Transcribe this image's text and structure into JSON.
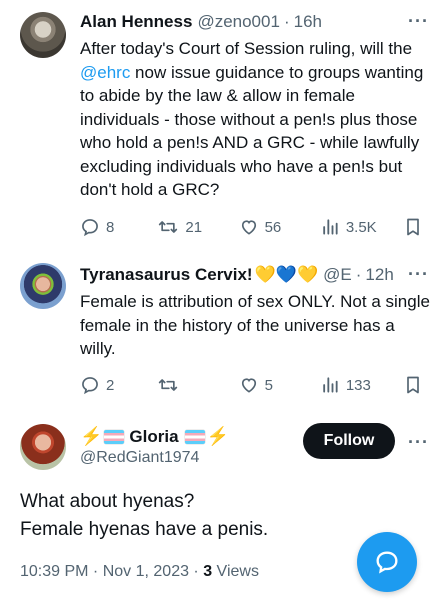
{
  "tweets": [
    {
      "name": "Alan Henness",
      "handle": "@zeno001",
      "time": "16h",
      "text_before": "After today's Court of Session ruling, will the ",
      "mention": "@ehrc",
      "text_after": " now issue guidance to groups wanting to abide by the law & allow in female individuals - those without a pen!s plus those who hold a pen!s AND a GRC - while lawfully excluding individuals who have a pen!s but don't hold a GRC?",
      "replies": "8",
      "retweets": "21",
      "likes": "56",
      "views": "3.5K"
    },
    {
      "name": "Tyranasaurus Cervix!",
      "name_emojis": "💛💙💛",
      "handle": "@E",
      "time": "12h",
      "text": "Female is attribution of sex ONLY. Not a single female in the history of the universe has a willy.",
      "replies": "2",
      "retweets": "",
      "likes": "5",
      "views": "133"
    }
  ],
  "main_tweet": {
    "name": "Gloria",
    "name_prefix": "⚡",
    "name_suffix": "⚡",
    "handle": "@RedGiant1974",
    "follow_label": "Follow",
    "line1": "What about hyenas?",
    "line2": "Female hyenas have a penis.",
    "timestamp": "10:39 PM · Nov 1, 2023 · ",
    "views_count": "3",
    "views_label": " Views"
  },
  "more_symbol": "···",
  "time_sep": "·",
  "icons": [
    "reply-icon",
    "retweet-icon",
    "heart-icon",
    "views-icon",
    "bookmark-icon",
    "compose-reply-icon"
  ],
  "colors": {
    "accent": "#1d9bf0",
    "text": "#0f1419",
    "muted": "#536471"
  }
}
